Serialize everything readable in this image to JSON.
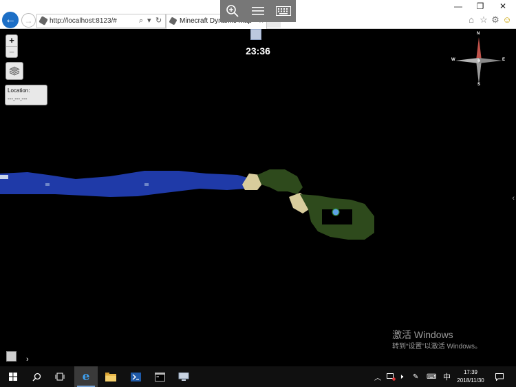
{
  "browser": {
    "url": "http://localhost:8123/#",
    "tab_title": "Minecraft Dynamic Map",
    "tab_close": "×",
    "search_glyph": "⌕",
    "dropdown_glyph": "▾",
    "refresh_glyph": "↻"
  },
  "window": {
    "minimize": "—",
    "restore": "❐",
    "close": "✕"
  },
  "map": {
    "zoom_in": "+",
    "zoom_out": "−",
    "location_label": "Location:",
    "location_value": "---,---,---",
    "clock": "23:36",
    "compass": {
      "n": "N",
      "s": "S",
      "e": "E",
      "w": "W"
    }
  },
  "watermark": {
    "line1": "激活 Windows",
    "line2": "转到“设置”以激活 Windows。"
  },
  "taskbar": {
    "ime": "中",
    "time": "17:39",
    "date": "2018/11/30"
  },
  "colors": {
    "water": "#1f3aa8",
    "grass": "#2e4a1c",
    "sand": "#d8cc9c",
    "accent": "#1d6fc6"
  }
}
